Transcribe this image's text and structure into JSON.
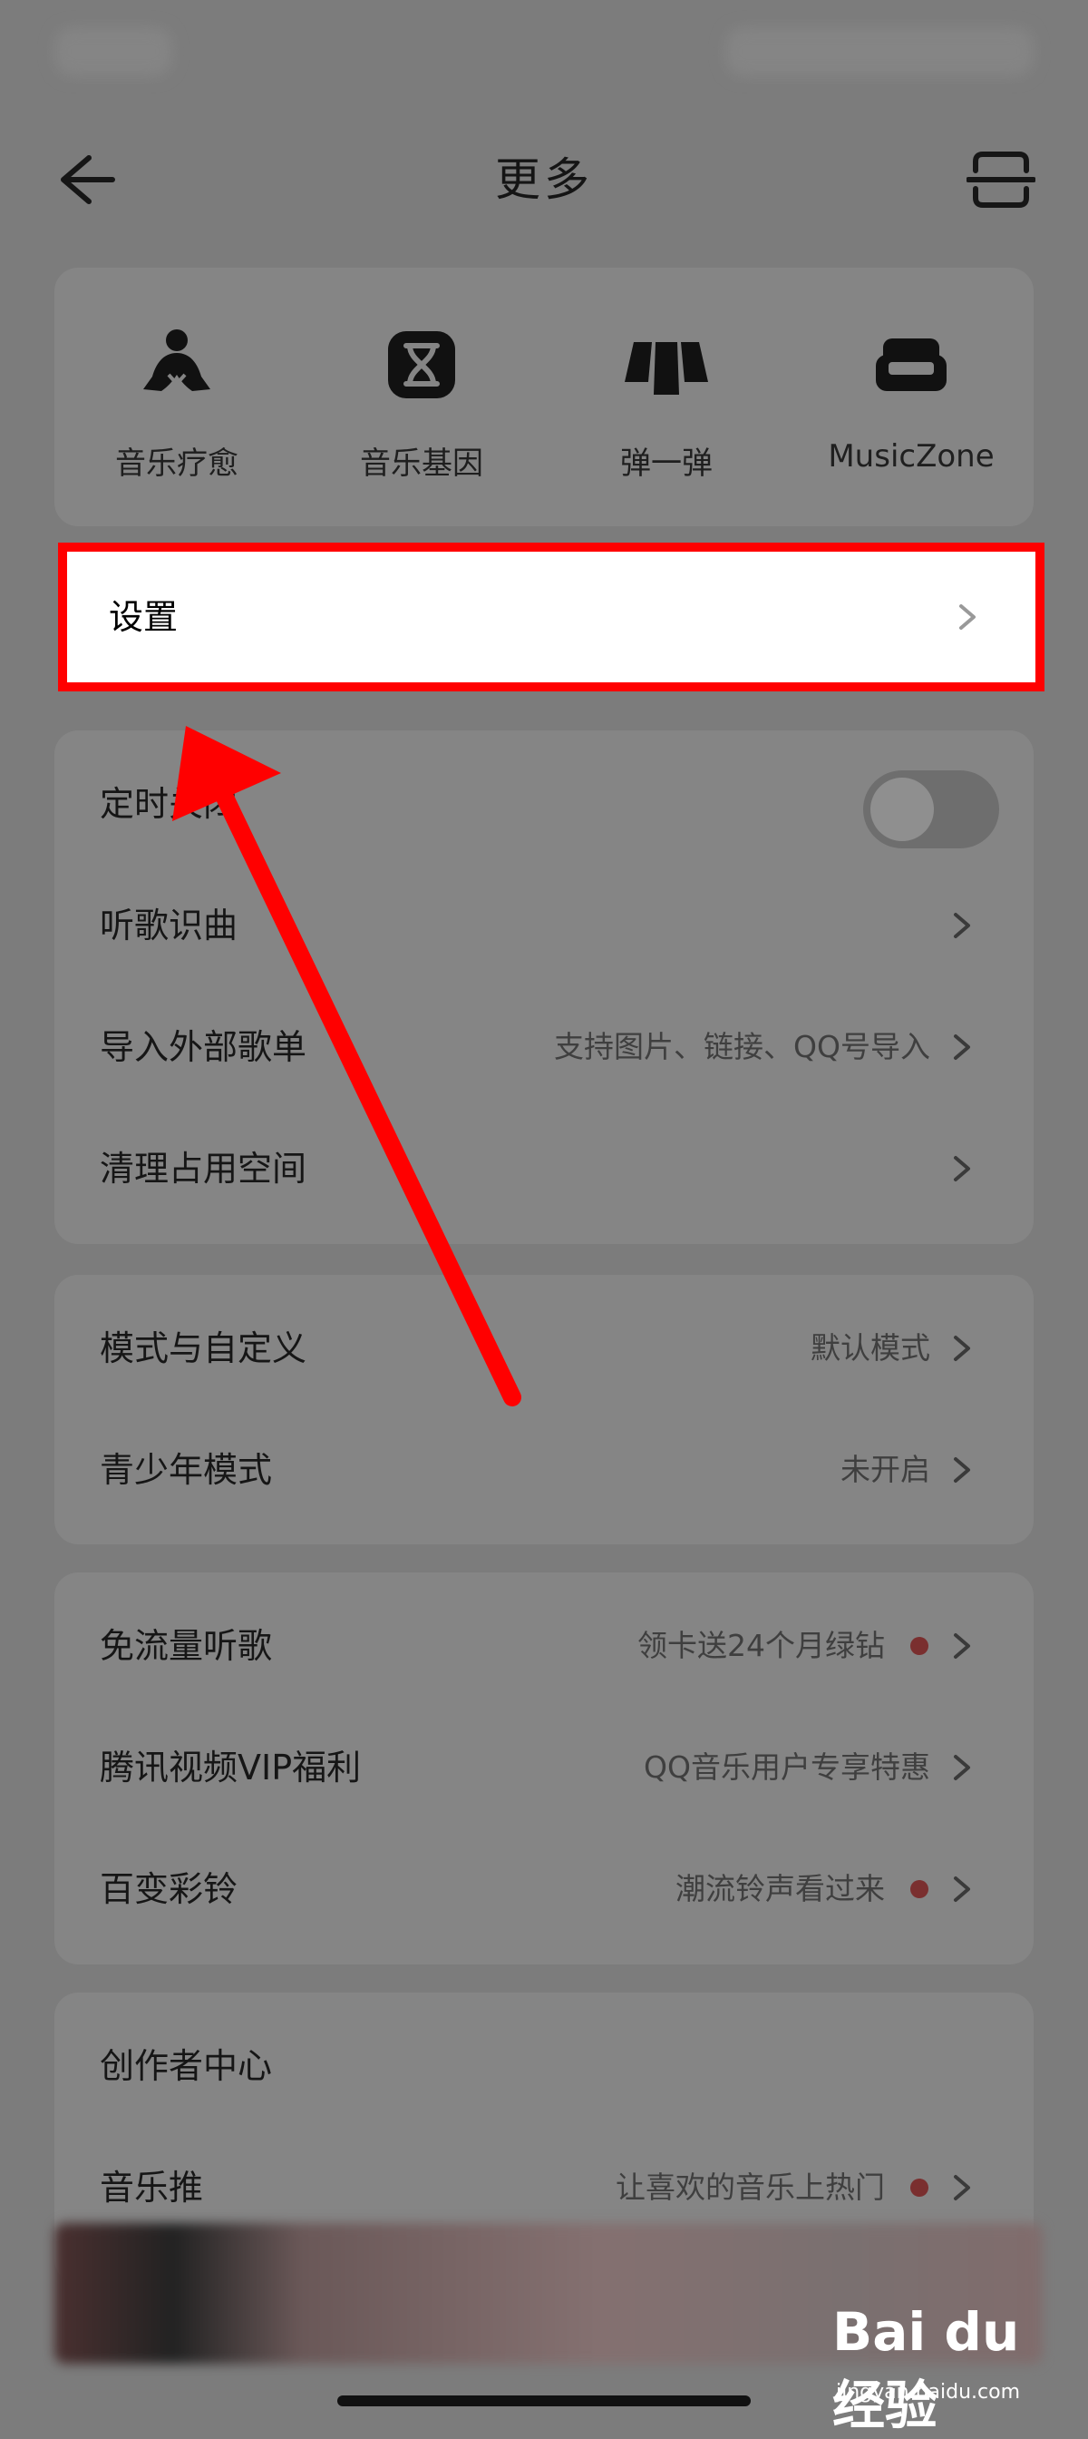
{
  "header": {
    "title": "更多",
    "back_icon": "arrow-left-icon",
    "scan_icon": "scan-icon"
  },
  "features": [
    {
      "label": "音乐疗愈",
      "icon": "meditation-person-icon"
    },
    {
      "label": "音乐基因",
      "icon": "dna-icon"
    },
    {
      "label": "弹一弹",
      "icon": "piano-keys-icon"
    },
    {
      "label": "MusicZone",
      "icon": "sofa-icon"
    }
  ],
  "settings": {
    "label": "设置"
  },
  "group1": [
    {
      "label": "定时关闭",
      "toggle": false
    },
    {
      "label": "听歌识曲",
      "value": ""
    },
    {
      "label": "导入外部歌单",
      "value": "支持图片、链接、QQ号导入"
    },
    {
      "label": "清理占用空间",
      "value": ""
    }
  ],
  "group2": [
    {
      "label": "模式与自定义",
      "value": "默认模式"
    },
    {
      "label": "青少年模式",
      "value": "未开启"
    }
  ],
  "group3": [
    {
      "label": "免流量听歌",
      "value": "领卡送24个月绿钻",
      "dot": true
    },
    {
      "label": "腾讯视频VIP福利",
      "value": "QQ音乐用户专享特惠",
      "dot": false
    },
    {
      "label": "百变彩铃",
      "value": "潮流铃声看过来",
      "dot": true
    }
  ],
  "group4": [
    {
      "label": "创作者中心",
      "value": ""
    },
    {
      "label": "音乐推",
      "value": "让喜欢的音乐上热门",
      "dot": true
    }
  ],
  "watermark": {
    "logo": "Bai du 经验",
    "domain": "jingyan.baidu.com"
  },
  "colors": {
    "highlight": "#ff0000",
    "arrow": "#ff0000",
    "dot": "#7a2f2f"
  }
}
